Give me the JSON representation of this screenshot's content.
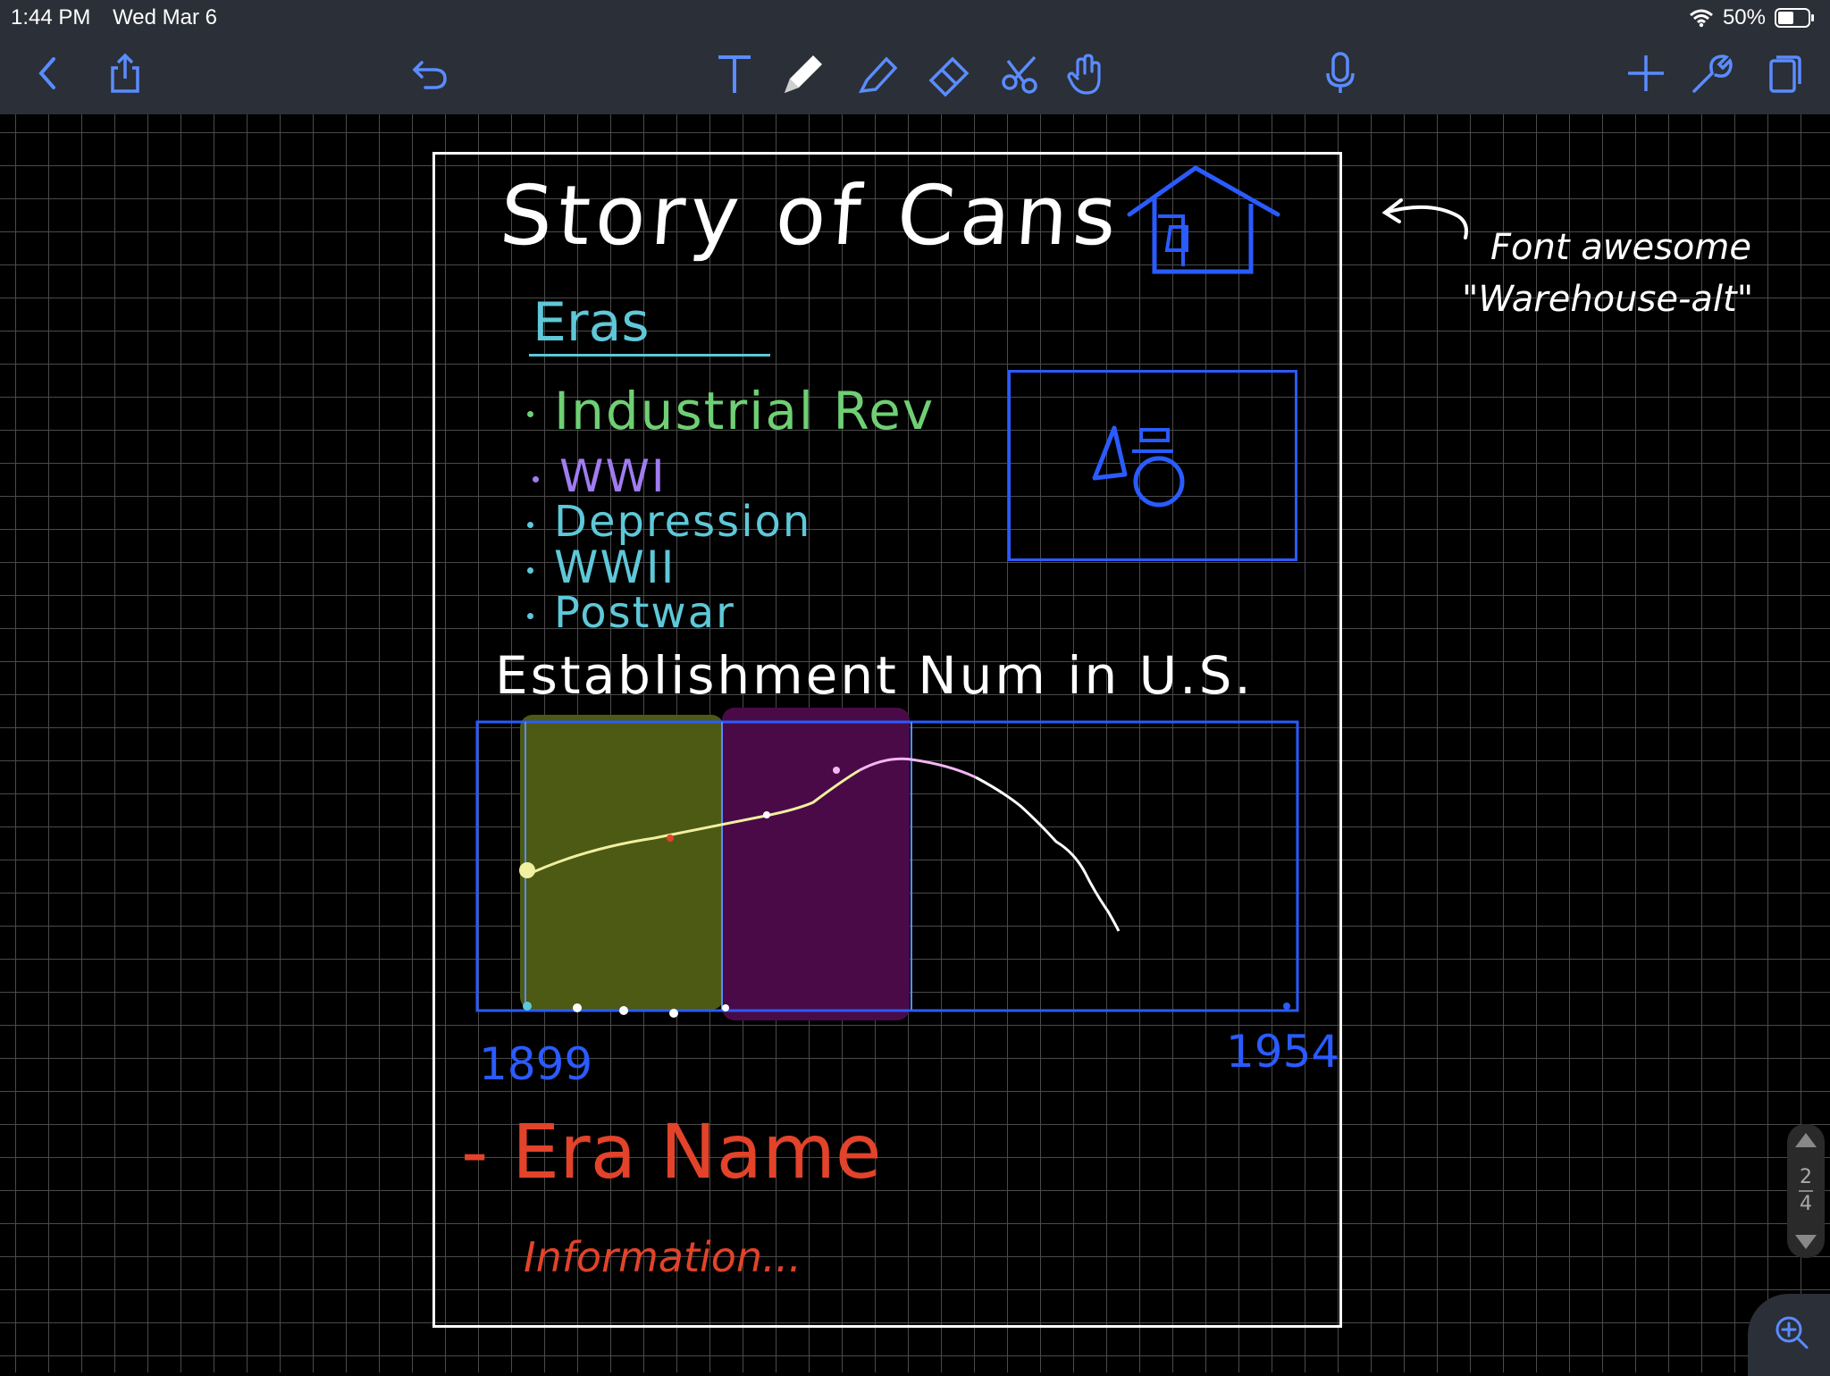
{
  "status": {
    "time": "1:44 PM",
    "date": "Wed Mar 6",
    "battery": "50%"
  },
  "toolbar": {
    "left_icons": [
      "back-icon",
      "share-icon",
      "undo-icon"
    ],
    "center_icons": [
      "text-tool-icon",
      "pen-tool-icon",
      "highlighter-tool-icon",
      "eraser-tool-icon",
      "lasso-scissors-icon",
      "hand-tool-icon"
    ],
    "mic_icon": "microphone-icon",
    "right_icons": [
      "add-icon",
      "wrench-icon",
      "pages-icon"
    ]
  },
  "note": {
    "title": "Story of Cans",
    "eras_heading": "Eras",
    "eras": [
      "Industrial Rev",
      "WWI",
      "Depression",
      "WWII",
      "Postwar"
    ],
    "eras_colors": [
      "#6fcf74",
      "#a07cf0",
      "#5ec8d8",
      "#5ec8d8",
      "#5ec8d8"
    ],
    "chart_heading": "Establishment Num in U.S.",
    "axis_start": "1899",
    "axis_end": "1954",
    "era_name": "- Era Name",
    "information": "Information...",
    "annotation_line1": "Font awesome",
    "annotation_line2": "\"Warehouse-alt\""
  },
  "pager": {
    "current": "2",
    "total": "4"
  },
  "colors": {
    "toolbar_bg": "#2b2f37",
    "pen_blue": "#2a5bff",
    "pen_red": "#e2432a",
    "pen_white": "#ffffff",
    "pen_cyan": "#5ec8d8",
    "era1_fill": "#4d5a14",
    "era2_fill": "#4a0a47",
    "curve_pink": "#f3b6f3"
  }
}
